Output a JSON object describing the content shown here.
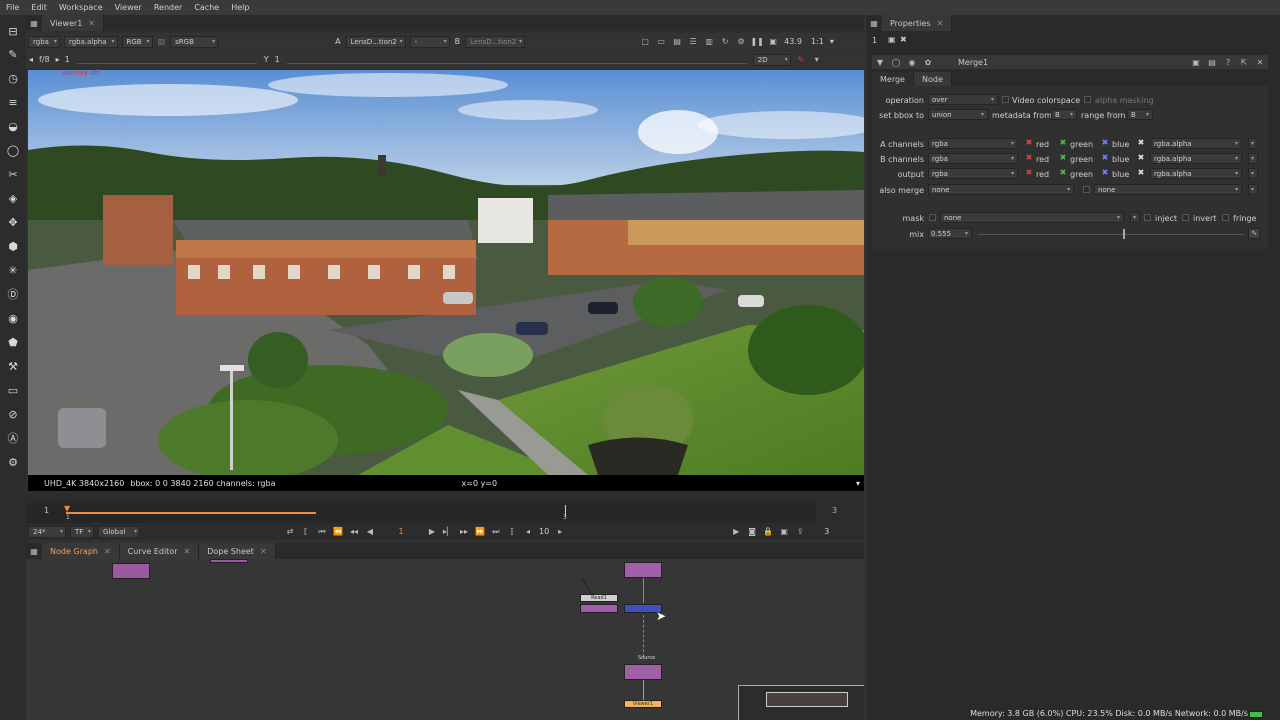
{
  "menu": [
    "File",
    "Edit",
    "Workspace",
    "Viewer",
    "Render",
    "Cache",
    "Help"
  ],
  "viewer": {
    "tab": "Viewer1",
    "channels": "rgba",
    "alpha": "rgba.alpha",
    "rgb": "RGB",
    "colorspace": "sRGB",
    "input_a_label": "A",
    "input_a": "LensD...tion2",
    "input_a_op": "-",
    "input_b_label": "B",
    "input_b": "LensD...tion2",
    "zoom": "43.9",
    "ratio": "1:1",
    "fstop": "f/8",
    "gain": "1",
    "gamma_label": "Y",
    "gamma": "1",
    "mode": "2D",
    "overlay": "overlay off",
    "info_format": "UHD_4K 3840x2160",
    "info_bbox": "bbox: 0 0 3840 2160 channels: rgba",
    "info_coords": "x=0 y=0"
  },
  "timeline": {
    "start": "1",
    "end": "3",
    "playhead_marker": "1",
    "midpoint_marker": "3",
    "fps": "24*",
    "tf": "TF",
    "scope": "Global",
    "frame": "1",
    "step": "10",
    "end_frame": "3"
  },
  "bottom_tabs": [
    "Node Graph",
    "Curve Editor",
    "Dope Sheet"
  ],
  "nodes": {
    "source_label": "Source",
    "viewer_label": "Viewer1",
    "read_label": "Read1"
  },
  "properties": {
    "tab": "Properties",
    "count": "1",
    "node_name": "Merge1",
    "subtabs": [
      "Merge",
      "Node"
    ],
    "operation_label": "operation",
    "operation": "over",
    "video_colorspace": "Video colorspace",
    "alpha_masking": "alpha masking",
    "bbox_label": "set bbox to",
    "bbox": "union",
    "metadata_label": "metadata from",
    "metadata": "B",
    "range_label": "range from",
    "range": "B",
    "a_channels_label": "A channels",
    "b_channels_label": "B channels",
    "output_label": "output",
    "also_merge_label": "also merge",
    "channel_value": "rgba",
    "channel_alpha": "rgba.alpha",
    "ch_red": "red",
    "ch_green": "green",
    "ch_blue": "blue",
    "none": "none",
    "mask_label": "mask",
    "mask": "none",
    "inject": "inject",
    "invert": "invert",
    "fringe": "fringe",
    "mix_label": "mix",
    "mix": "0.555"
  },
  "status": "Memory: 3.8 GB (6.0%) CPU: 23.5% Disk: 0.0 MB/s Network: 0.0 MB/s",
  "colors": {
    "accent": "#f08c3c",
    "red_check": "#e04040",
    "green_check": "#40c040",
    "blue_check": "#7080ff",
    "node_merge": "#4050c0",
    "node_lens": "#a060a8"
  }
}
